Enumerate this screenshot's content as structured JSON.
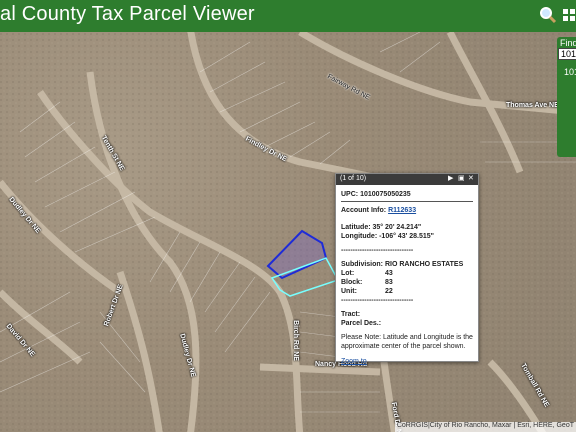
{
  "header": {
    "title": "al County Tax Parcel Viewer",
    "search_icon": "search-icon",
    "grid_icon": "grid-icon"
  },
  "find": {
    "label": "Find",
    "input_value": "1010",
    "result": "101"
  },
  "streets": {
    "fairway": "Fairway Rd NE",
    "thomas": "Thomas Ave NE",
    "findley": "Findley Dr NE",
    "tenth": "Tenth St NE",
    "dudley": "Dudley Dr NE",
    "robert": "Robert Dr NE",
    "david": "David Dr NE",
    "dudley2": "Dudley Dr NE",
    "birch": "Birch Rd NE",
    "nancy": "Nancy Hood Rd",
    "tomball": "Tomball Rd NE",
    "ford": "Ford Dr NE"
  },
  "popup": {
    "count": "(1 of 10)",
    "next_icon": "next-icon",
    "maximize_icon": "maximize-icon",
    "close_icon": "close-icon",
    "upc_label": "UPC:",
    "upc_value": "1010075050235",
    "account_label": "Account Info:",
    "account_value": "R112633",
    "latitude": "Latitude: 35° 20' 24.214\"",
    "longitude": "Longitude: -106° 43' 28.515\"",
    "separator": "-------------------------------",
    "subdivision_label": "Subdivision:",
    "subdivision_value": "RIO RANCHO ESTATES",
    "lot_label": "Lot:",
    "lot_value": "43",
    "block_label": "Block:",
    "block_value": "83",
    "unit_label": "Unit:",
    "unit_value": "22",
    "separator2": "-------------------------------",
    "tract_label": "Tract:",
    "parcel_label": "Parcel Des.:",
    "note": "Please Note: Latitude and Longitude is the approximate center of the parcel shown.",
    "zoom_label": "Zoom to"
  },
  "attribution": "CoRRGIS|City of Rio Rancho, Maxar | Esri, HERE, GeoT"
}
